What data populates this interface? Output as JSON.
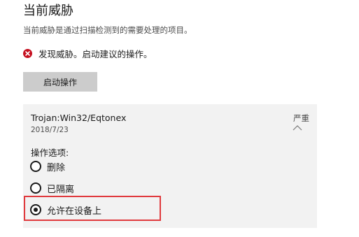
{
  "header": {
    "title": "当前威胁",
    "subtitle": "当前威胁是通过扫描检测到的需要处理的项目。"
  },
  "status": {
    "icon": "error-x-icon",
    "text": "发现威胁。启动建议的操作。",
    "color": "#c50f1f"
  },
  "action_button": {
    "label": "启动操作"
  },
  "threat": {
    "name": "Trojan:Win32/Eqtonex",
    "date": "2018/7/23",
    "severity": "严重",
    "options_label": "操作选项:",
    "options": [
      {
        "label": "删除",
        "selected": false
      },
      {
        "label": "已隔离",
        "selected": false
      },
      {
        "label": "允许在设备上",
        "selected": true
      }
    ]
  },
  "colors": {
    "highlight": "#e03a3e",
    "card_background": "#f2f2f2",
    "button_background": "#cccccc"
  }
}
